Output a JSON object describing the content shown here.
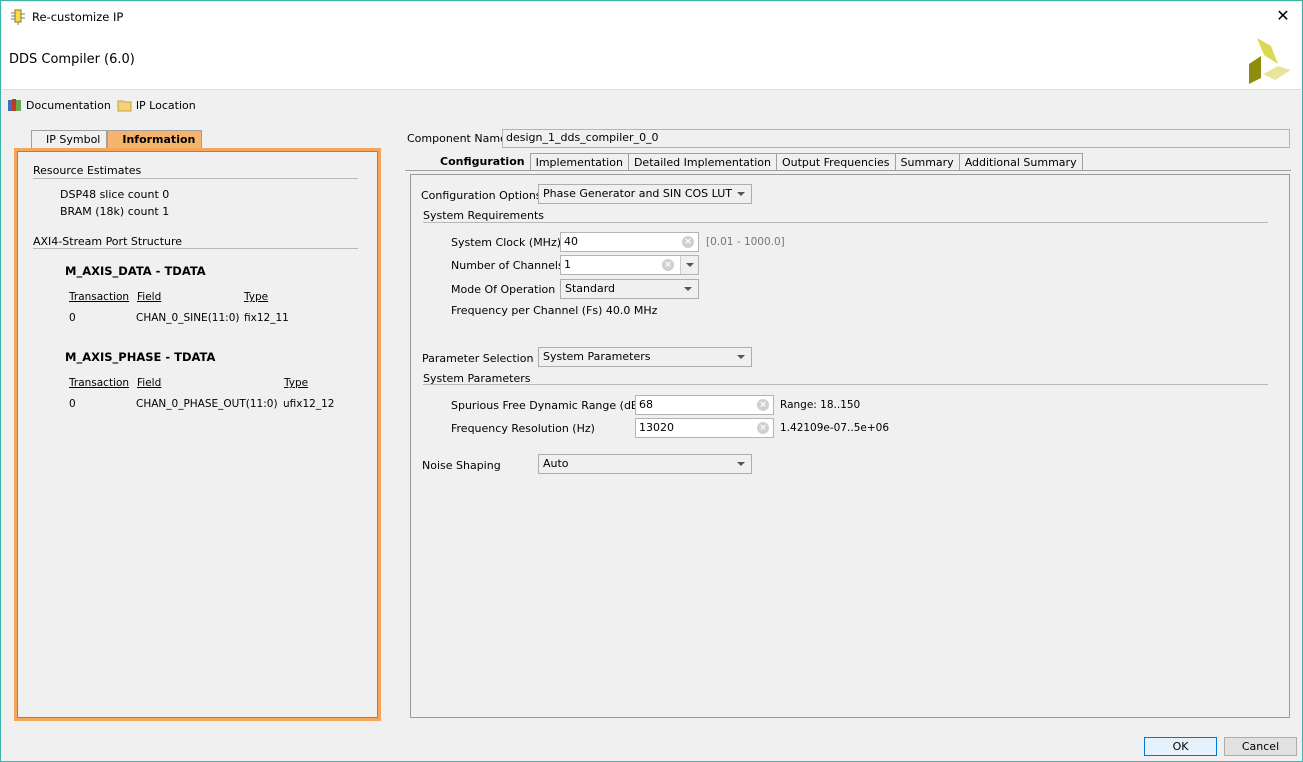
{
  "window": {
    "title": "Re-customize IP",
    "close_icon": "close-icon"
  },
  "header": {
    "ip_title": "DDS Compiler (6.0)",
    "logo": "xilinx-logo"
  },
  "toolbar": {
    "documentation_label": "Documentation",
    "ip_location_label": "IP Location"
  },
  "left_panel": {
    "tabs": [
      {
        "label": "IP Symbol",
        "active": false
      },
      {
        "label": "Information",
        "active": true
      }
    ],
    "resource_estimates": {
      "heading": "Resource Estimates",
      "dsp48": "DSP48 slice count 0",
      "bram": "BRAM (18k) count 1"
    },
    "port_structure": {
      "heading": "AXI4-Stream Port Structure",
      "ports": [
        {
          "title": "M_AXIS_DATA - TDATA",
          "headers": [
            "Transaction",
            "Field",
            "Type"
          ],
          "rows": [
            [
              "0",
              "CHAN_0_SINE(11:0)",
              "fix12_11"
            ]
          ]
        },
        {
          "title": "M_AXIS_PHASE - TDATA",
          "headers": [
            "Transaction",
            "Field",
            "Type"
          ],
          "rows": [
            [
              "0",
              "CHAN_0_PHASE_OUT(11:0)",
              "ufix12_12"
            ]
          ]
        }
      ]
    }
  },
  "main": {
    "component_name_label": "Component Name",
    "component_name_value": "design_1_dds_compiler_0_0",
    "tabs": [
      {
        "label": "Configuration",
        "active": true
      },
      {
        "label": "Implementation",
        "active": false
      },
      {
        "label": "Detailed Implementation",
        "active": false
      },
      {
        "label": "Output Frequencies",
        "active": false
      },
      {
        "label": "Summary",
        "active": false
      },
      {
        "label": "Additional Summary",
        "active": false
      }
    ],
    "configuration": {
      "config_options_label": "Configuration Options",
      "config_options_value": "Phase Generator and SIN COS LUT",
      "system_requirements_heading": "System Requirements",
      "system_clock_label": "System Clock (MHz)",
      "system_clock_value": "40",
      "system_clock_range": "[0.01 - 1000.0]",
      "num_channels_label": "Number of Channels",
      "num_channels_value": "1",
      "mode_label": "Mode Of Operation",
      "mode_value": "Standard",
      "freq_per_channel": "Frequency per Channel (Fs) 40.0 MHz",
      "param_selection_label": "Parameter Selection",
      "param_selection_value": "System Parameters",
      "system_parameters_heading": "System Parameters",
      "sfdr_label": "Spurious Free Dynamic Range (dB)",
      "sfdr_value": "68",
      "sfdr_range": "Range: 18..150",
      "freq_res_label": "Frequency Resolution (Hz)",
      "freq_res_value": "13020",
      "freq_res_range": "1.42109e-07..5e+06",
      "noise_shaping_label": "Noise Shaping",
      "noise_shaping_value": "Auto"
    }
  },
  "footer": {
    "ok_label": "OK",
    "cancel_label": "Cancel"
  }
}
